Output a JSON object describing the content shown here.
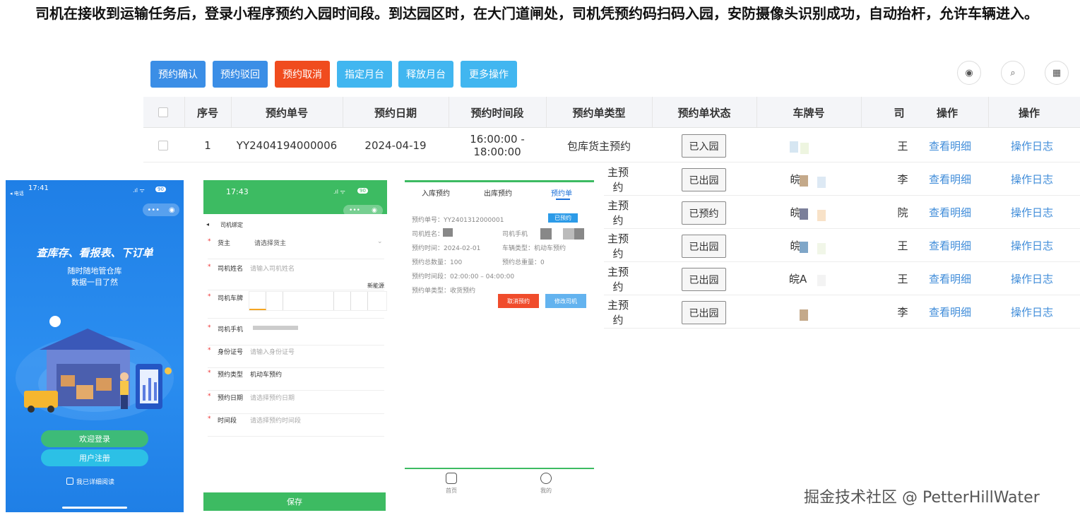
{
  "intro": "司机在接收到运输任务后，登录小程序预约入园时间段。到达园区时，在大门道闸处，司机凭预约码扫码入园，安防摄像头识别成功，自动抬杆，允许车辆进入。",
  "toolbar": {
    "buttons": [
      {
        "label": "预约确认",
        "color": "#3b8ee6"
      },
      {
        "label": "预约驳回",
        "color": "#3b8ee6"
      },
      {
        "label": "预约取消",
        "color": "#f04c1e"
      },
      {
        "label": "指定月台",
        "color": "#41b6f0"
      },
      {
        "label": "释放月台",
        "color": "#41b6f0"
      },
      {
        "label": "更多操作",
        "color": "#41b6f0"
      }
    ],
    "icons": [
      "eye-icon",
      "search-icon",
      "grid-icon"
    ]
  },
  "table": {
    "headers": [
      "序号",
      "预约单号",
      "预约日期",
      "预约时间段",
      "预约单类型",
      "预约单状态",
      "车牌号",
      "司",
      "操作",
      "操作"
    ],
    "first_row": {
      "index": "1",
      "order_no": "YY2404194000006",
      "date": "2024-04-19",
      "time": "16:00:00 - 18:00:00",
      "type": "包库货主预约",
      "status": "已入园",
      "plate": "",
      "driver": "王",
      "detail": "查看明细",
      "log": "操作日志"
    },
    "rows": [
      {
        "type_tail": "主预约",
        "status": "已出园",
        "plate": "皖",
        "driver": "李",
        "detail": "查看明细",
        "log": "操作日志"
      },
      {
        "type_tail": "主预约",
        "status": "已预约",
        "plate": "皖",
        "driver": "院",
        "detail": "查看明细",
        "log": "操作日志"
      },
      {
        "type_tail": "主预约",
        "status": "已出园",
        "plate": "皖",
        "driver": "王",
        "detail": "查看明细",
        "log": "操作日志"
      },
      {
        "type_tail": "主预约",
        "status": "已出园",
        "plate": "皖A",
        "driver": "王",
        "detail": "查看明细",
        "log": "操作日志"
      },
      {
        "type_tail": "主预约",
        "status": "已出园",
        "plate": "",
        "driver": "李",
        "detail": "查看明细",
        "log": "操作日志"
      }
    ]
  },
  "phone1": {
    "time": "17:41",
    "carrier": "◂ 电话",
    "battery": "90",
    "slogan": "查库存、看报表、下订单",
    "sub1": "随时随地管仓库",
    "sub2": "数据一目了然",
    "login": "欢迎登录",
    "register": "用户注册",
    "agree": "我已详细阅读"
  },
  "phone2": {
    "time": "17:43",
    "battery": "90",
    "back": "司机绑定",
    "fields": [
      {
        "label": "货主",
        "value": "请选择货主"
      },
      {
        "label": "司机姓名",
        "value": "请输入司机姓名"
      },
      {
        "label": "司机车牌",
        "value": ""
      },
      {
        "label": "司机手机",
        "value": ""
      },
      {
        "label": "身份证号",
        "value": "请输入身份证号"
      },
      {
        "label": "预约类型",
        "value": "机动车预约"
      },
      {
        "label": "预约日期",
        "value": "请选择预约日期"
      },
      {
        "label": "时间段",
        "value": "请选择预约时间段"
      }
    ],
    "newenergy": "新能源",
    "save": "保存"
  },
  "phone3": {
    "tabs": [
      "入库预约",
      "出库预约",
      "预约单"
    ],
    "order_label": "预约单号：YY2401312000001",
    "badge": "已预约",
    "driver_name": "司机姓名：",
    "driver_phone": "司机手机",
    "time": "预约时间：2024-02-01",
    "vehicle": "车辆类型：机动车预约",
    "qty": "预约总数量：100",
    "weight": "预约总重量：0",
    "period": "预约时间段：02:00:00 – 04:00:00",
    "otype": "预约单类型：收货预约",
    "cancel": "取消预约",
    "edit": "修改司机",
    "nav_home": "首页",
    "nav_me": "我的"
  },
  "watermark": "掘金技术社区 @ PetterHillWater"
}
